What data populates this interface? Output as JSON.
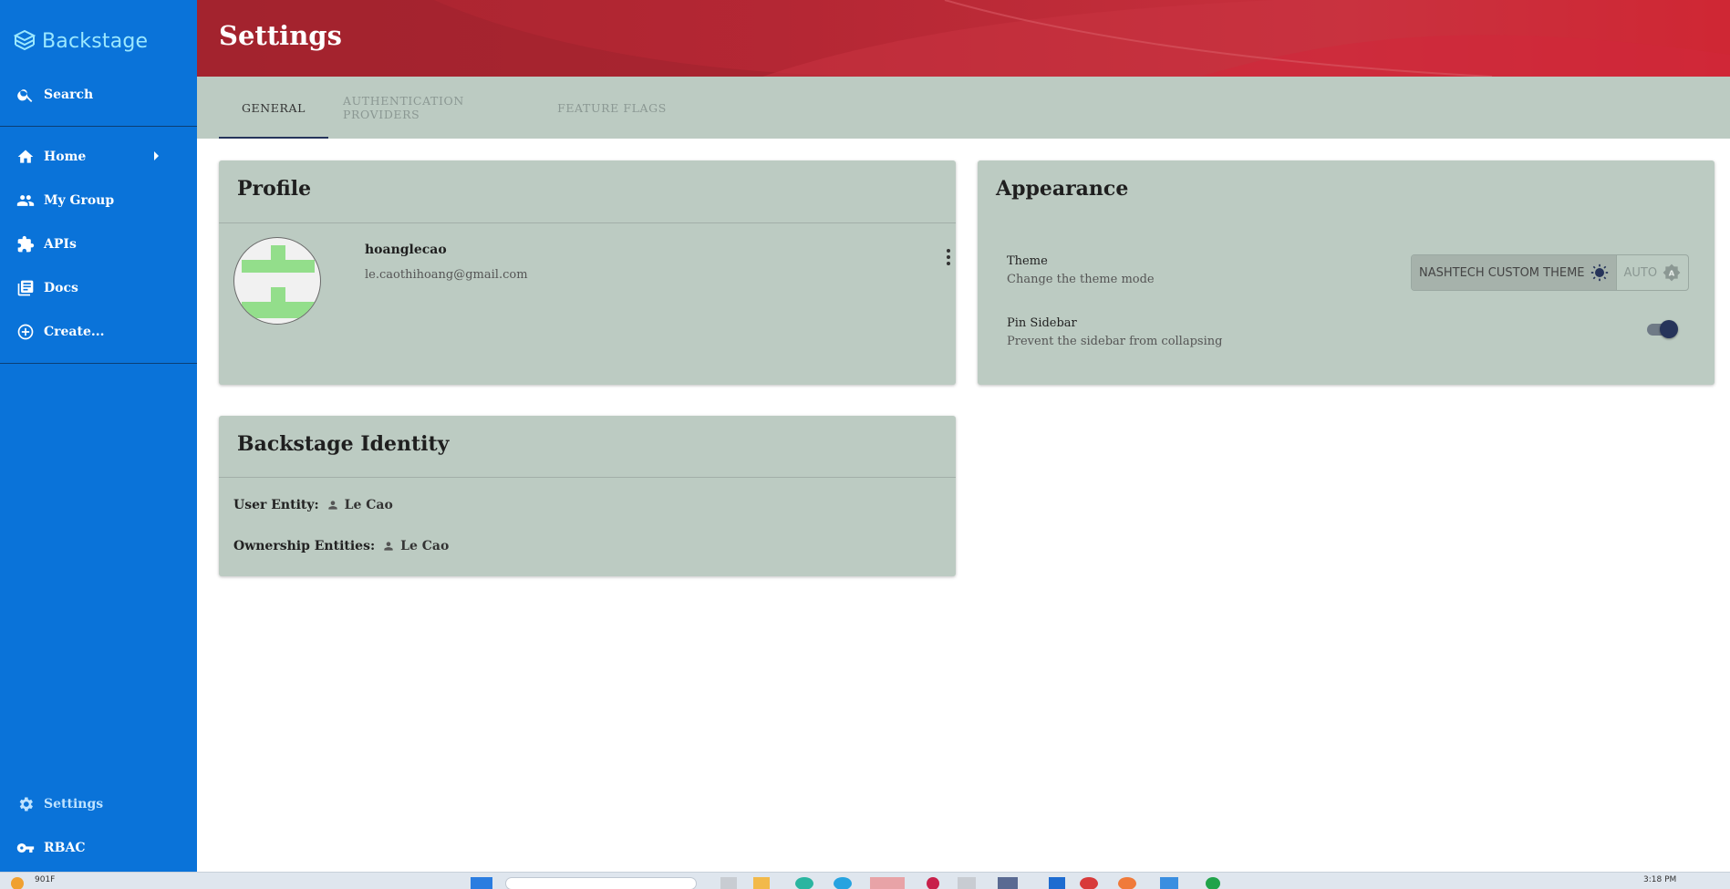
{
  "app": {
    "brand": "Backstage"
  },
  "sidebar": {
    "search_label": "Search",
    "items": [
      {
        "label": "Home",
        "icon": "home-icon"
      },
      {
        "label": "My Group",
        "icon": "group-icon"
      },
      {
        "label": "APIs",
        "icon": "puzzle-icon"
      },
      {
        "label": "Docs",
        "icon": "library-icon"
      },
      {
        "label": "Create...",
        "icon": "add-circle-icon"
      }
    ],
    "bottom_items": [
      {
        "label": "Settings",
        "icon": "gear-icon"
      },
      {
        "label": "RBAC",
        "icon": "key-icon"
      }
    ]
  },
  "header": {
    "title": "Settings"
  },
  "tabs": [
    "GENERAL",
    "AUTHENTICATION PROVIDERS",
    "FEATURE FLAGS"
  ],
  "profile": {
    "title": "Profile",
    "username": "hoanglecao",
    "email": "le.caothihoang@gmail.com"
  },
  "appearance": {
    "title": "Appearance",
    "theme_label": "Theme",
    "theme_sub": "Change the theme mode",
    "theme_options": [
      "NASHTECH CUSTOM THEME",
      "AUTO"
    ],
    "theme_selected": "NASHTECH CUSTOM THEME",
    "pin_label": "Pin Sidebar",
    "pin_sub": "Prevent the sidebar from collapsing",
    "pin_enabled": true
  },
  "identity": {
    "title": "Backstage Identity",
    "user_entity_label": "User Entity:",
    "user_entity_value": "Le Cao",
    "ownership_label": "Ownership Entities:",
    "ownership_value": "Le Cao"
  },
  "taskbar": {
    "left_text": "901F",
    "clock": "3:18 PM"
  },
  "colors": {
    "sidebar": "#0a73d9",
    "header": "#b52734",
    "card": "#bccbc2",
    "accent": "#26345a",
    "brand_text": "#9be8ff"
  }
}
